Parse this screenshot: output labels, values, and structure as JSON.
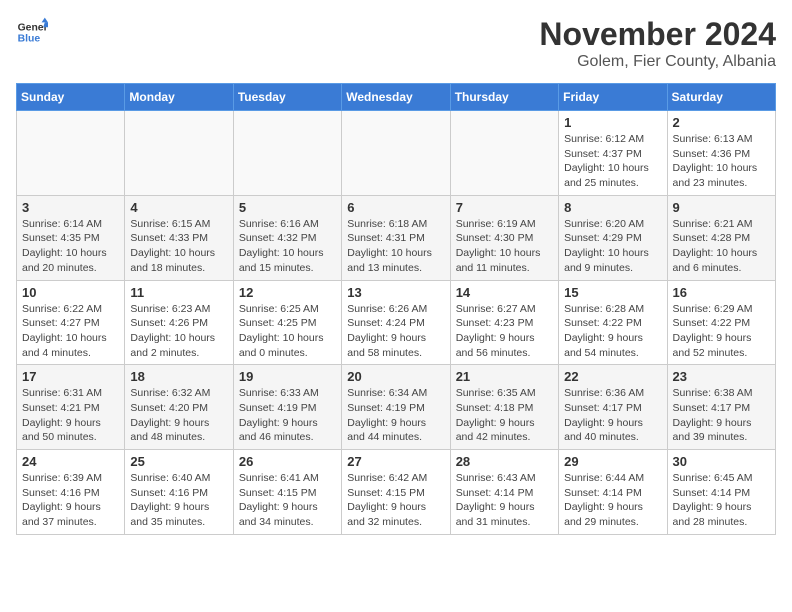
{
  "logo": {
    "text_general": "General",
    "text_blue": "Blue"
  },
  "title": "November 2024",
  "location": "Golem, Fier County, Albania",
  "headers": [
    "Sunday",
    "Monday",
    "Tuesday",
    "Wednesday",
    "Thursday",
    "Friday",
    "Saturday"
  ],
  "weeks": [
    [
      {
        "day": "",
        "info": ""
      },
      {
        "day": "",
        "info": ""
      },
      {
        "day": "",
        "info": ""
      },
      {
        "day": "",
        "info": ""
      },
      {
        "day": "",
        "info": ""
      },
      {
        "day": "1",
        "info": "Sunrise: 6:12 AM\nSunset: 4:37 PM\nDaylight: 10 hours and 25 minutes."
      },
      {
        "day": "2",
        "info": "Sunrise: 6:13 AM\nSunset: 4:36 PM\nDaylight: 10 hours and 23 minutes."
      }
    ],
    [
      {
        "day": "3",
        "info": "Sunrise: 6:14 AM\nSunset: 4:35 PM\nDaylight: 10 hours and 20 minutes."
      },
      {
        "day": "4",
        "info": "Sunrise: 6:15 AM\nSunset: 4:33 PM\nDaylight: 10 hours and 18 minutes."
      },
      {
        "day": "5",
        "info": "Sunrise: 6:16 AM\nSunset: 4:32 PM\nDaylight: 10 hours and 15 minutes."
      },
      {
        "day": "6",
        "info": "Sunrise: 6:18 AM\nSunset: 4:31 PM\nDaylight: 10 hours and 13 minutes."
      },
      {
        "day": "7",
        "info": "Sunrise: 6:19 AM\nSunset: 4:30 PM\nDaylight: 10 hours and 11 minutes."
      },
      {
        "day": "8",
        "info": "Sunrise: 6:20 AM\nSunset: 4:29 PM\nDaylight: 10 hours and 9 minutes."
      },
      {
        "day": "9",
        "info": "Sunrise: 6:21 AM\nSunset: 4:28 PM\nDaylight: 10 hours and 6 minutes."
      }
    ],
    [
      {
        "day": "10",
        "info": "Sunrise: 6:22 AM\nSunset: 4:27 PM\nDaylight: 10 hours and 4 minutes."
      },
      {
        "day": "11",
        "info": "Sunrise: 6:23 AM\nSunset: 4:26 PM\nDaylight: 10 hours and 2 minutes."
      },
      {
        "day": "12",
        "info": "Sunrise: 6:25 AM\nSunset: 4:25 PM\nDaylight: 10 hours and 0 minutes."
      },
      {
        "day": "13",
        "info": "Sunrise: 6:26 AM\nSunset: 4:24 PM\nDaylight: 9 hours and 58 minutes."
      },
      {
        "day": "14",
        "info": "Sunrise: 6:27 AM\nSunset: 4:23 PM\nDaylight: 9 hours and 56 minutes."
      },
      {
        "day": "15",
        "info": "Sunrise: 6:28 AM\nSunset: 4:22 PM\nDaylight: 9 hours and 54 minutes."
      },
      {
        "day": "16",
        "info": "Sunrise: 6:29 AM\nSunset: 4:22 PM\nDaylight: 9 hours and 52 minutes."
      }
    ],
    [
      {
        "day": "17",
        "info": "Sunrise: 6:31 AM\nSunset: 4:21 PM\nDaylight: 9 hours and 50 minutes."
      },
      {
        "day": "18",
        "info": "Sunrise: 6:32 AM\nSunset: 4:20 PM\nDaylight: 9 hours and 48 minutes."
      },
      {
        "day": "19",
        "info": "Sunrise: 6:33 AM\nSunset: 4:19 PM\nDaylight: 9 hours and 46 minutes."
      },
      {
        "day": "20",
        "info": "Sunrise: 6:34 AM\nSunset: 4:19 PM\nDaylight: 9 hours and 44 minutes."
      },
      {
        "day": "21",
        "info": "Sunrise: 6:35 AM\nSunset: 4:18 PM\nDaylight: 9 hours and 42 minutes."
      },
      {
        "day": "22",
        "info": "Sunrise: 6:36 AM\nSunset: 4:17 PM\nDaylight: 9 hours and 40 minutes."
      },
      {
        "day": "23",
        "info": "Sunrise: 6:38 AM\nSunset: 4:17 PM\nDaylight: 9 hours and 39 minutes."
      }
    ],
    [
      {
        "day": "24",
        "info": "Sunrise: 6:39 AM\nSunset: 4:16 PM\nDaylight: 9 hours and 37 minutes."
      },
      {
        "day": "25",
        "info": "Sunrise: 6:40 AM\nSunset: 4:16 PM\nDaylight: 9 hours and 35 minutes."
      },
      {
        "day": "26",
        "info": "Sunrise: 6:41 AM\nSunset: 4:15 PM\nDaylight: 9 hours and 34 minutes."
      },
      {
        "day": "27",
        "info": "Sunrise: 6:42 AM\nSunset: 4:15 PM\nDaylight: 9 hours and 32 minutes."
      },
      {
        "day": "28",
        "info": "Sunrise: 6:43 AM\nSunset: 4:14 PM\nDaylight: 9 hours and 31 minutes."
      },
      {
        "day": "29",
        "info": "Sunrise: 6:44 AM\nSunset: 4:14 PM\nDaylight: 9 hours and 29 minutes."
      },
      {
        "day": "30",
        "info": "Sunrise: 6:45 AM\nSunset: 4:14 PM\nDaylight: 9 hours and 28 minutes."
      }
    ]
  ]
}
